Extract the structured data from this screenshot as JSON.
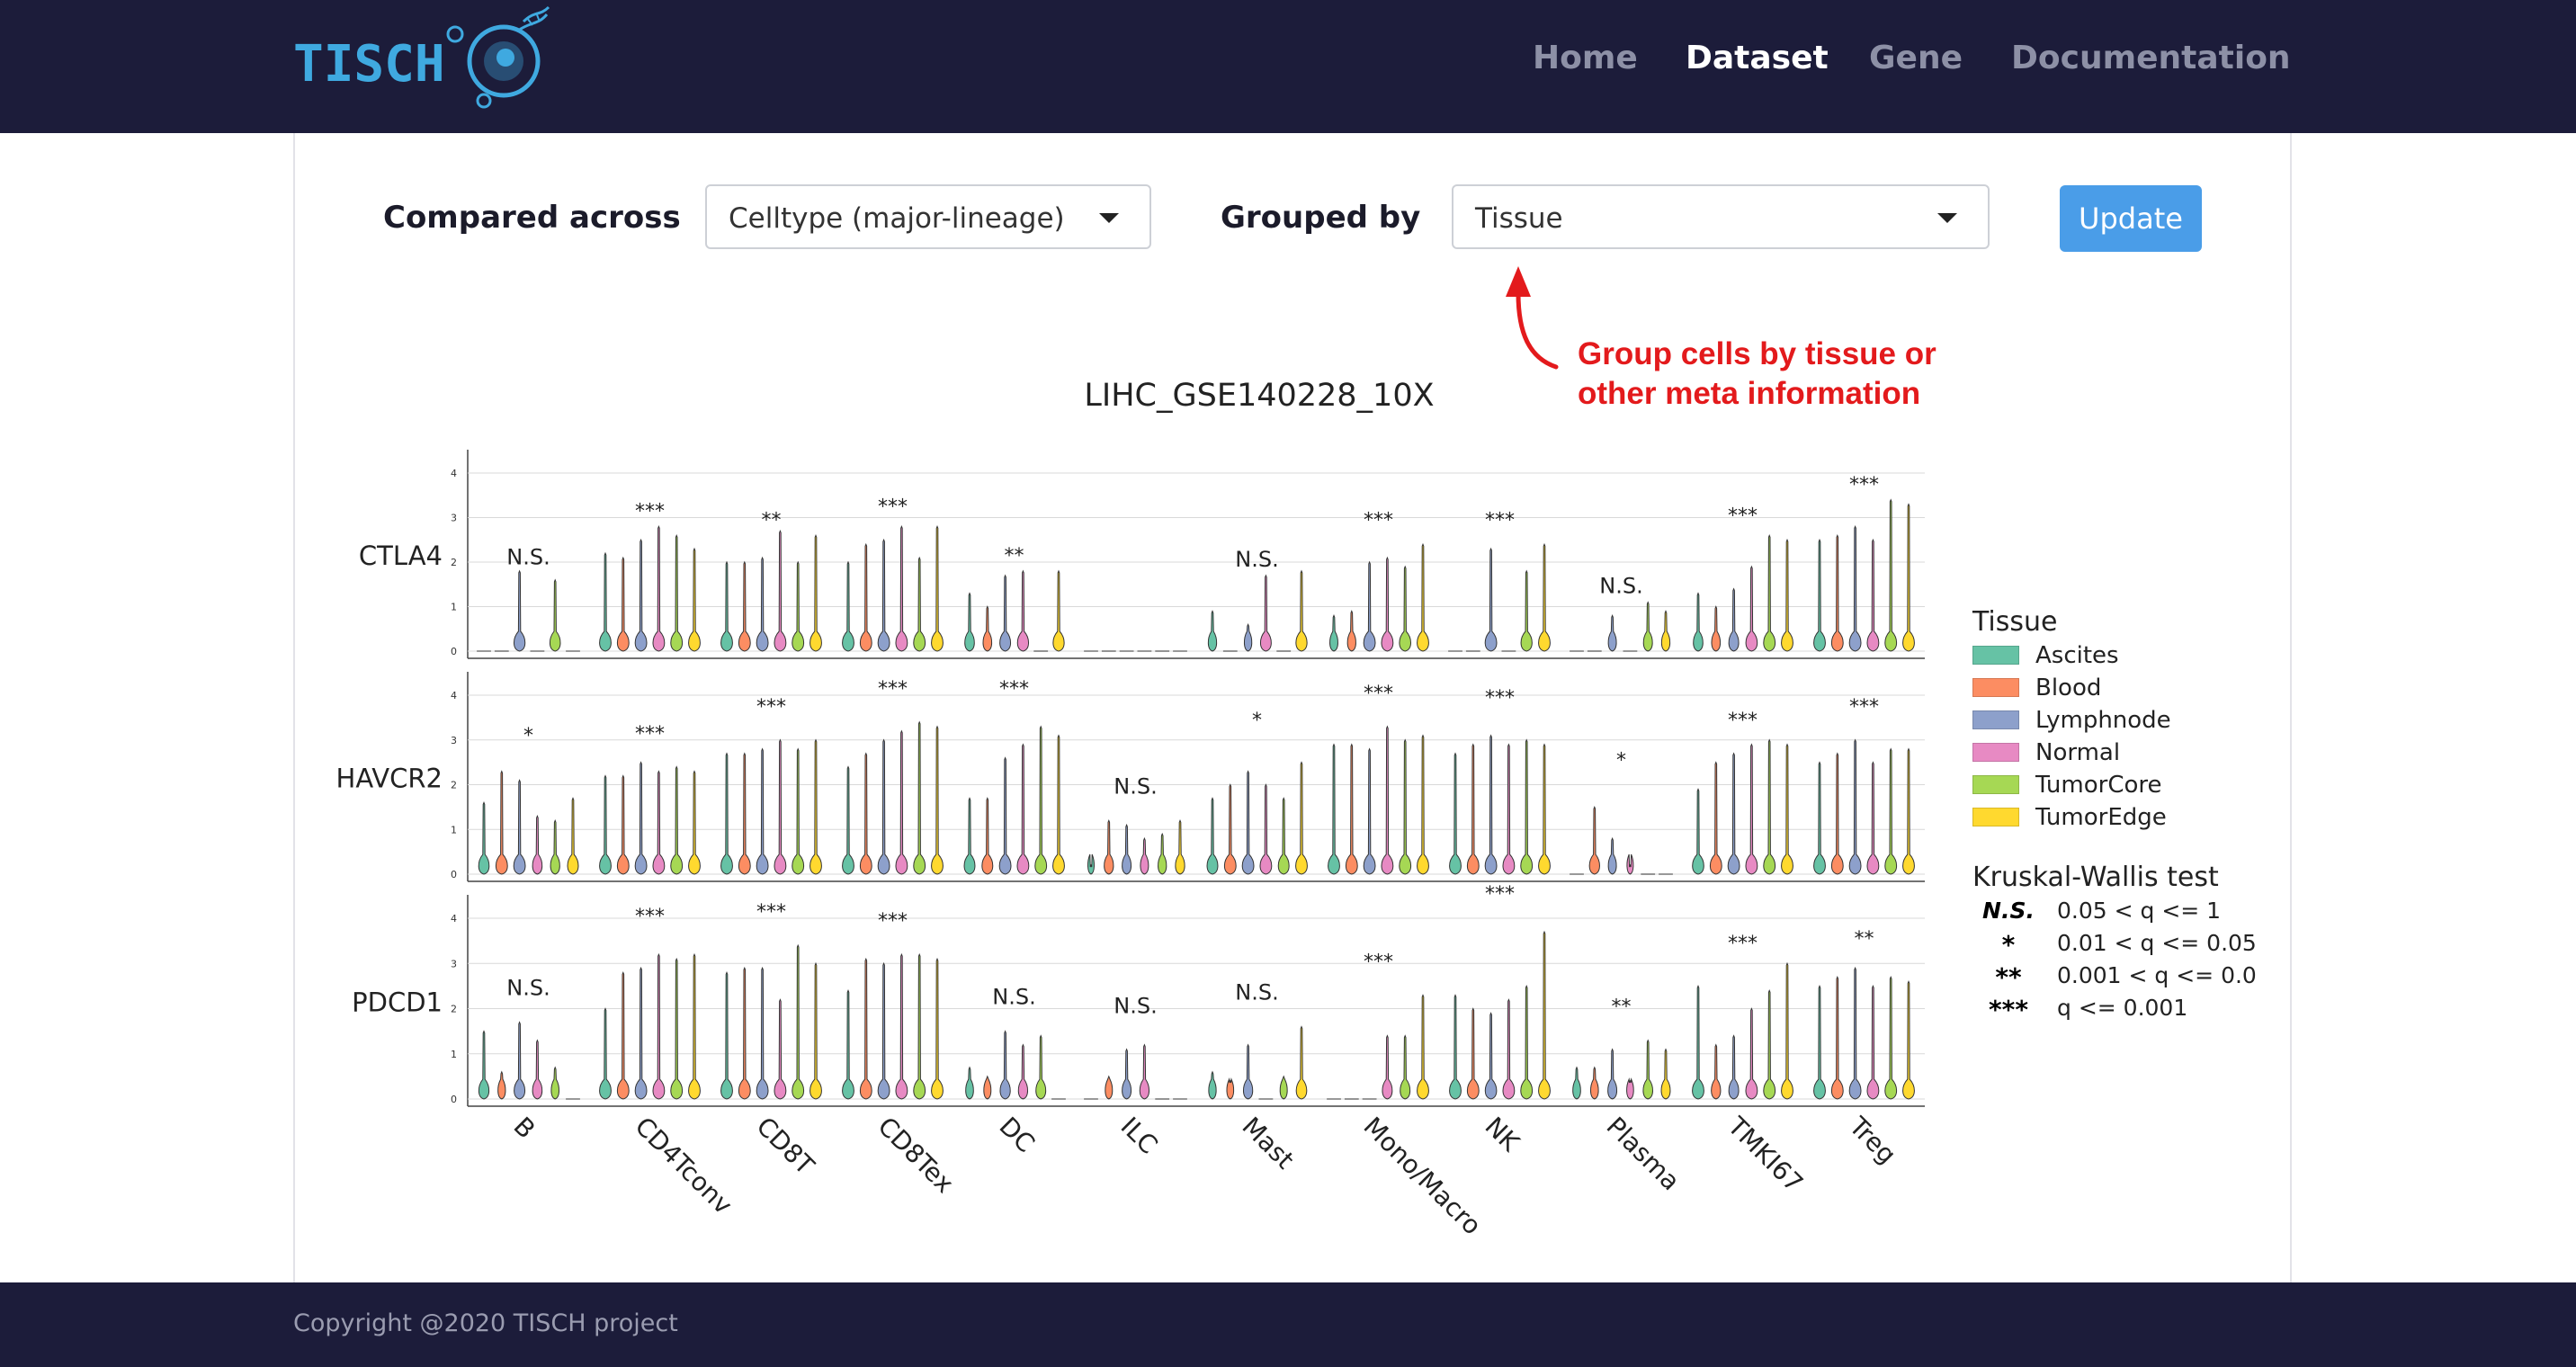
{
  "brand": {
    "name": "TISCH"
  },
  "nav": {
    "items": [
      "Home",
      "Dataset",
      "Gene",
      "Documentation"
    ],
    "active": "Dataset"
  },
  "controls": {
    "compared_label": "Compared across",
    "compared_value": "Celltype (major-lineage)",
    "grouped_label": "Grouped by",
    "grouped_value": "Tissue",
    "update_label": "Update"
  },
  "annotation": {
    "text": "Group cells by tissue or other meta information",
    "color": "#e31a1c"
  },
  "colors": {
    "navbar": "#1c1c3a",
    "update_button": "#4a9de8"
  },
  "chart_data": {
    "type": "violin",
    "title": "LIHC_GSE140228_10X",
    "genes": [
      "CTLA4",
      "HAVCR2",
      "PDCD1"
    ],
    "categories": [
      "B",
      "CD4Tconv",
      "CD8T",
      "CD8Tex",
      "DC",
      "ILC",
      "Mast",
      "Mono/Macro",
      "NK",
      "Plasma",
      "TMKI67",
      "Treg"
    ],
    "y_ticks": [
      "0",
      "1",
      "2",
      "3",
      "4"
    ],
    "ylim": [
      0,
      4
    ],
    "grid": true,
    "legend_title": "Tissue",
    "legend_position": "right",
    "groups": [
      "Ascites",
      "Blood",
      "Lymphnode",
      "Normal",
      "TumorCore",
      "TumorEdge"
    ],
    "group_colors": [
      "#66c2a5",
      "#fc8d62",
      "#8da0cb",
      "#e78ac3",
      "#a6d854",
      "#ffd92f"
    ],
    "max_values": {
      "CTLA4": [
        [
          0,
          0,
          1.8,
          0,
          1.6,
          0
        ],
        [
          2.2,
          2.1,
          2.5,
          2.8,
          2.6,
          2.3
        ],
        [
          2.0,
          2.0,
          2.1,
          2.7,
          2.0,
          2.6
        ],
        [
          2.0,
          2.4,
          2.5,
          2.8,
          2.1,
          2.8
        ],
        [
          1.3,
          1.0,
          1.7,
          1.8,
          0,
          1.8
        ],
        [
          0,
          0,
          0,
          0,
          0,
          0
        ],
        [
          0.9,
          0,
          0.6,
          1.7,
          0,
          1.8
        ],
        [
          0.8,
          0.9,
          2.0,
          2.1,
          1.9,
          2.4
        ],
        [
          0,
          0,
          2.3,
          0,
          1.8,
          2.4
        ],
        [
          0,
          0,
          0.8,
          0,
          1.1,
          0.9
        ],
        [
          1.3,
          1.0,
          1.4,
          1.9,
          2.6,
          2.5
        ],
        [
          2.5,
          2.6,
          2.8,
          2.5,
          3.4,
          3.3
        ]
      ],
      "HAVCR2": [
        [
          1.6,
          2.3,
          2.1,
          1.3,
          1.2,
          1.7
        ],
        [
          2.2,
          2.2,
          2.5,
          2.3,
          2.4,
          2.3
        ],
        [
          2.7,
          2.7,
          2.8,
          3.0,
          2.8,
          3.0
        ],
        [
          2.4,
          2.7,
          3.0,
          3.2,
          3.4,
          3.3
        ],
        [
          1.7,
          1.7,
          2.6,
          2.9,
          3.3,
          3.1
        ],
        [
          0.2,
          1.2,
          1.1,
          0.8,
          0.9,
          1.2
        ],
        [
          1.7,
          2.0,
          2.3,
          2.0,
          1.7,
          2.5
        ],
        [
          2.9,
          2.9,
          2.8,
          3.3,
          3.0,
          3.1
        ],
        [
          2.7,
          2.9,
          3.1,
          2.9,
          3.0,
          2.9
        ],
        [
          0,
          1.5,
          0.8,
          0.2,
          0,
          0
        ],
        [
          1.9,
          2.5,
          2.7,
          2.9,
          3.0,
          2.9
        ],
        [
          2.5,
          2.7,
          3.0,
          2.5,
          2.8,
          2.8
        ]
      ],
      "PDCD1": [
        [
          1.5,
          0.6,
          1.7,
          1.3,
          0.7,
          0
        ],
        [
          2.0,
          2.8,
          2.9,
          3.2,
          3.1,
          3.2
        ],
        [
          2.8,
          2.9,
          2.9,
          2.2,
          3.4,
          3.0
        ],
        [
          2.4,
          3.1,
          3.0,
          3.2,
          3.2,
          3.1
        ],
        [
          0.7,
          0.5,
          1.5,
          1.2,
          1.4,
          0
        ],
        [
          0,
          0.5,
          1.1,
          1.2,
          0,
          0
        ],
        [
          0.6,
          0.4,
          1.2,
          0,
          0.5,
          1.6
        ],
        [
          0,
          0,
          0,
          1.4,
          1.4,
          2.3
        ],
        [
          2.3,
          2.0,
          1.9,
          2.2,
          2.5,
          3.7
        ],
        [
          0.7,
          0.7,
          1.1,
          0.4,
          1.3,
          1.1
        ],
        [
          2.5,
          1.2,
          1.4,
          2.0,
          2.4,
          3.0
        ],
        [
          2.5,
          2.7,
          2.9,
          2.5,
          2.7,
          2.6
        ]
      ]
    },
    "significance": {
      "CTLA4": [
        "N.S.",
        "***",
        "**",
        "***",
        "**",
        "",
        "N.S.",
        "***",
        "***",
        "N.S.",
        "***",
        "***"
      ],
      "HAVCR2": [
        "*",
        "***",
        "***",
        "***",
        "***",
        "N.S.",
        "*",
        "***",
        "***",
        "*",
        "***",
        "***"
      ],
      "PDCD1": [
        "N.S.",
        "***",
        "***",
        "***",
        "N.S.",
        "N.S.",
        "N.S.",
        "***",
        "***",
        "**",
        "***",
        "**"
      ]
    },
    "significance_values": {
      "CTLA4": [
        1.95,
        3.0,
        2.8,
        3.1,
        2.0,
        null,
        1.9,
        2.8,
        2.8,
        1.3,
        2.9,
        3.6
      ],
      "HAVCR2": [
        2.95,
        3.0,
        3.6,
        4.0,
        4.0,
        1.8,
        3.3,
        3.9,
        3.8,
        2.4,
        3.3,
        3.6
      ],
      "PDCD1": [
        2.3,
        3.9,
        4.0,
        3.8,
        2.1,
        1.9,
        2.2,
        2.9,
        4.4,
        1.9,
        3.3,
        3.4
      ]
    },
    "test_legend": {
      "title": "Kruskal-Wallis test",
      "rows": [
        {
          "symbol": "N.S.",
          "text": "0.05 < q <= 1"
        },
        {
          "symbol": "*",
          "text": "0.01 < q <= 0.05"
        },
        {
          "symbol": "**",
          "text": "0.001 < q <= 0.0"
        },
        {
          "symbol": "***",
          "text": "q <= 0.001"
        }
      ]
    }
  },
  "footer": {
    "copyright": "Copyright @2020 TISCH project"
  }
}
